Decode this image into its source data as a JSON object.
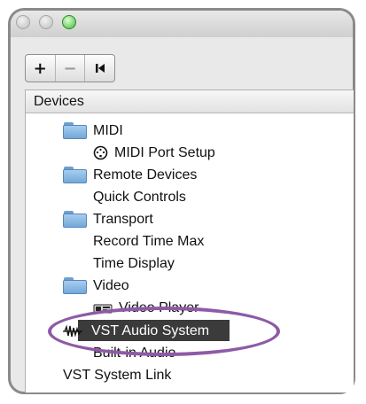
{
  "toolbar": {
    "add_label": "+",
    "remove_label": "−",
    "reset_icon": "skip-back-icon"
  },
  "panel": {
    "header": "Devices"
  },
  "tree": {
    "midi": "MIDI",
    "midi_port_setup": "MIDI Port Setup",
    "remote_devices": "Remote Devices",
    "quick_controls": "Quick Controls",
    "transport": "Transport",
    "record_time_max": "Record Time Max",
    "time_display": "Time Display",
    "video": "Video",
    "video_player": "Video Player",
    "vst_audio_system": "VST Audio System",
    "built_in_audio": "Built-in Audio",
    "vst_system_link": "VST System Link"
  },
  "colors": {
    "selection": "#3b3b3b",
    "highlight_oval": "#8e5aa6",
    "folder": "#74a8d8",
    "zoom_light": "#45b83c"
  }
}
